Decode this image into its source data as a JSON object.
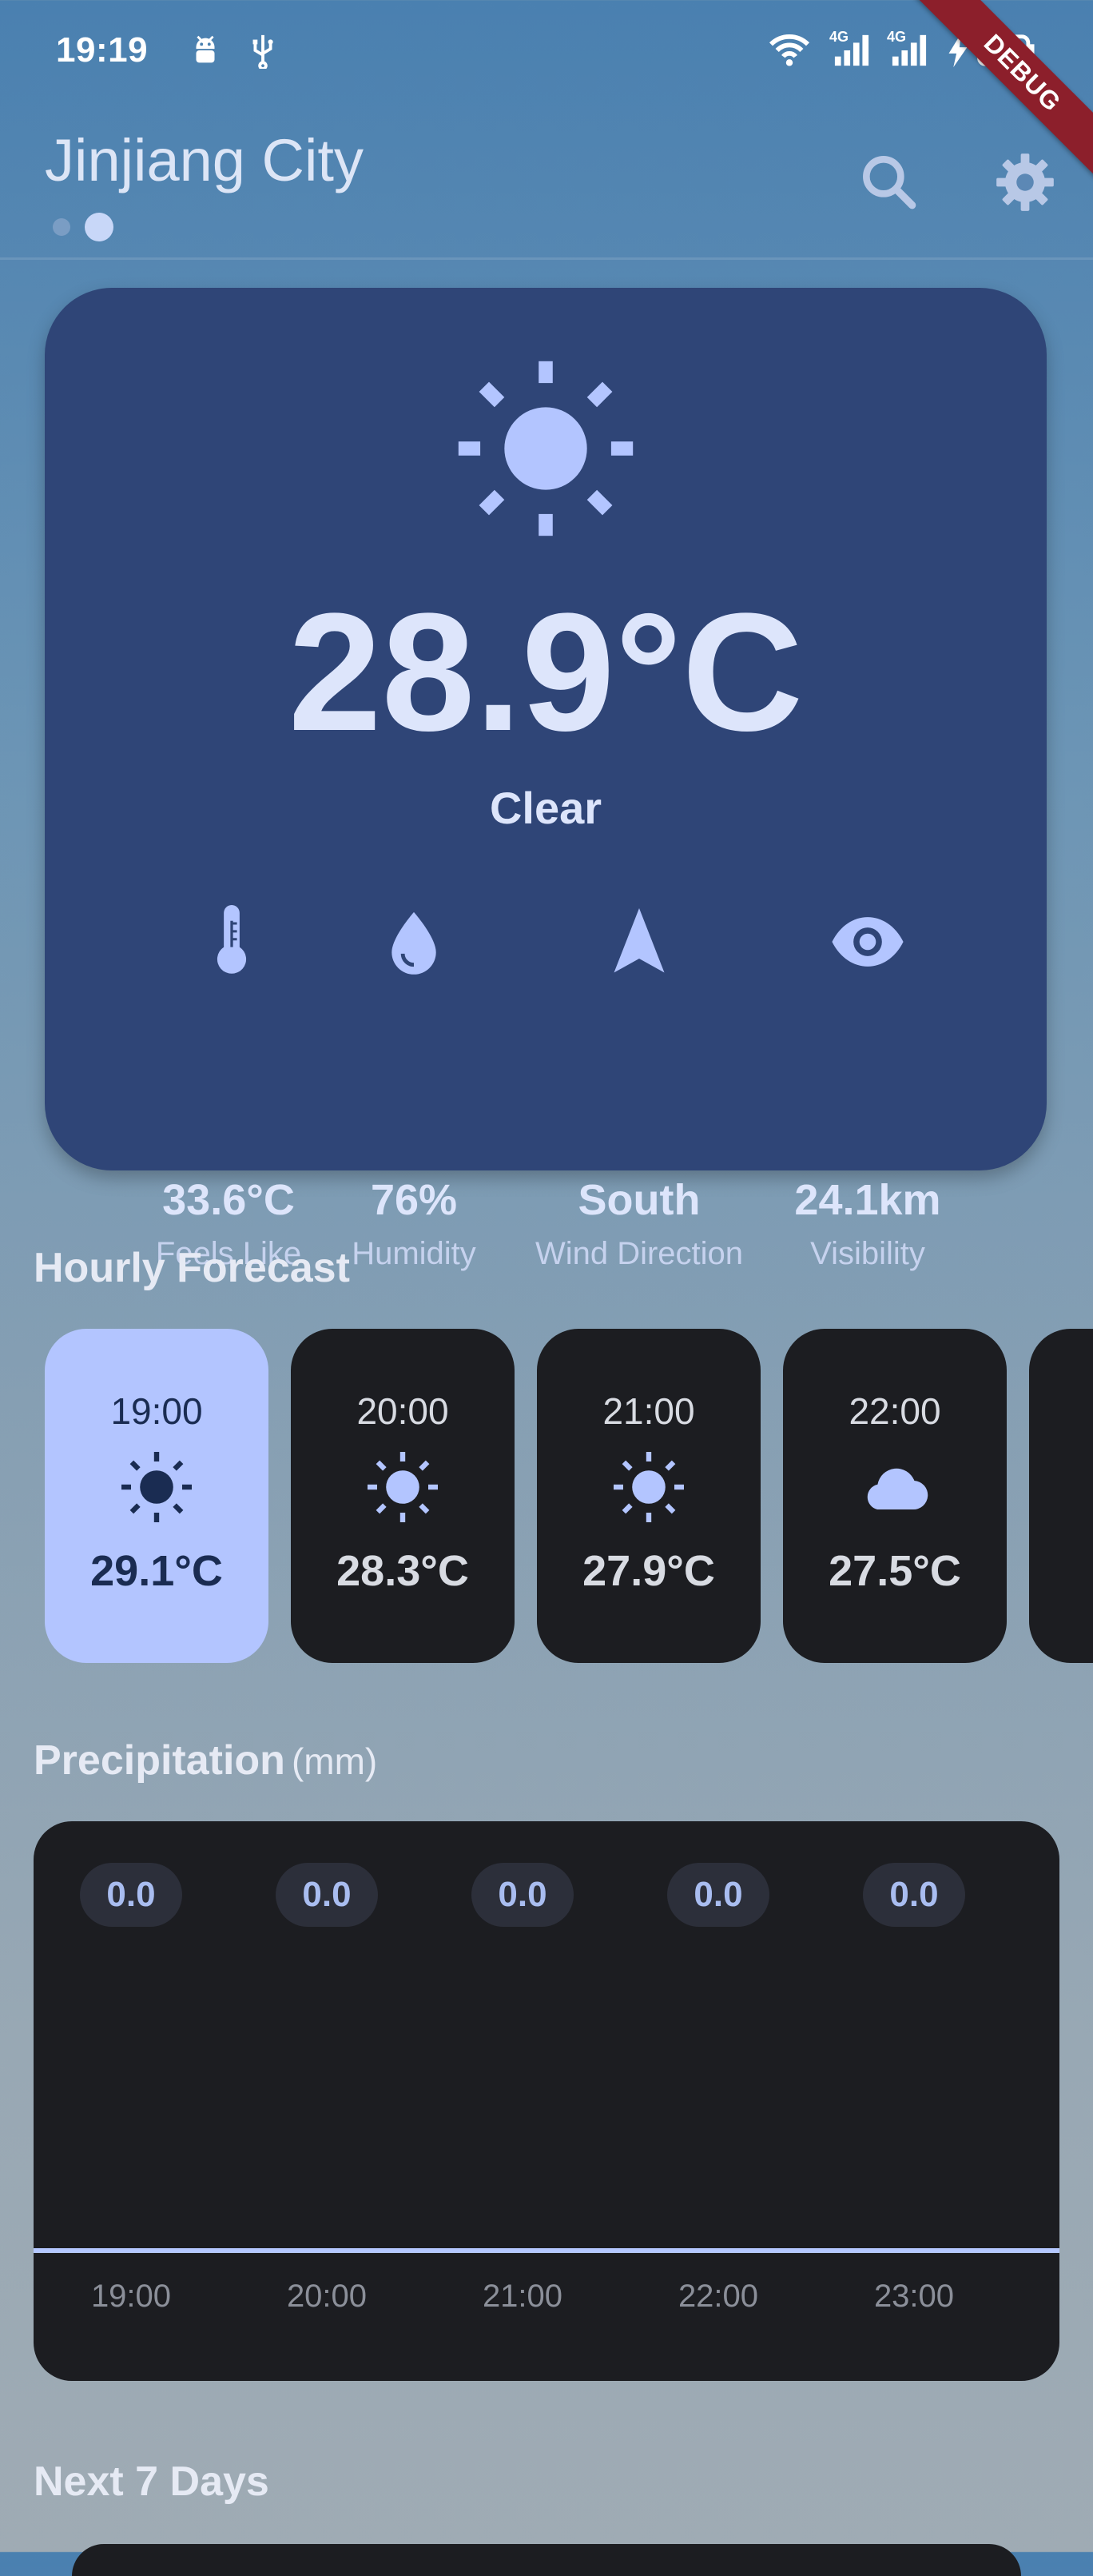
{
  "status_bar": {
    "time": "19:19",
    "network_labels": [
      "4G",
      "4G"
    ],
    "battery_percent": ""
  },
  "debug_banner": "DEBUG",
  "header": {
    "city": "Jinjiang City",
    "pages": 2,
    "active_page": 2,
    "icons": [
      "search-icon",
      "gear-icon"
    ]
  },
  "current": {
    "icon": "sun-icon",
    "temperature": "28.9°C",
    "condition": "Clear",
    "metrics": [
      {
        "icon": "thermometer-icon",
        "value": "33.6°C",
        "label": "Feels Like"
      },
      {
        "icon": "water-drop-icon",
        "value": "76%",
        "label": "Humidity"
      },
      {
        "icon": "navigation-arrow-icon",
        "value": "South",
        "label": "Wind Direction"
      },
      {
        "icon": "eye-icon",
        "value": "24.1km",
        "label": "Visibility"
      }
    ]
  },
  "hourly": {
    "title": "Hourly Forecast",
    "items": [
      {
        "time": "19:00",
        "icon": "sun-icon",
        "temp": "29.1°C",
        "selected": true
      },
      {
        "time": "20:00",
        "icon": "sun-icon",
        "temp": "28.3°C",
        "selected": false
      },
      {
        "time": "21:00",
        "icon": "sun-icon",
        "temp": "27.9°C",
        "selected": false
      },
      {
        "time": "22:00",
        "icon": "cloud-icon",
        "temp": "27.5°C",
        "selected": false
      }
    ]
  },
  "precipitation": {
    "title": "Precipitation",
    "unit": "(mm)",
    "values": [
      "0.0",
      "0.0",
      "0.0",
      "0.0",
      "0.0"
    ],
    "times": [
      "19:00",
      "20:00",
      "21:00",
      "22:00",
      "23:00"
    ]
  },
  "next_days": {
    "title": "Next 7 Days"
  },
  "colors": {
    "card_dark_blue": "#2f4577",
    "accent_light": "#b3c5ff",
    "panel_dark": "#1c1d21",
    "debug_red": "#8c1f2b"
  }
}
